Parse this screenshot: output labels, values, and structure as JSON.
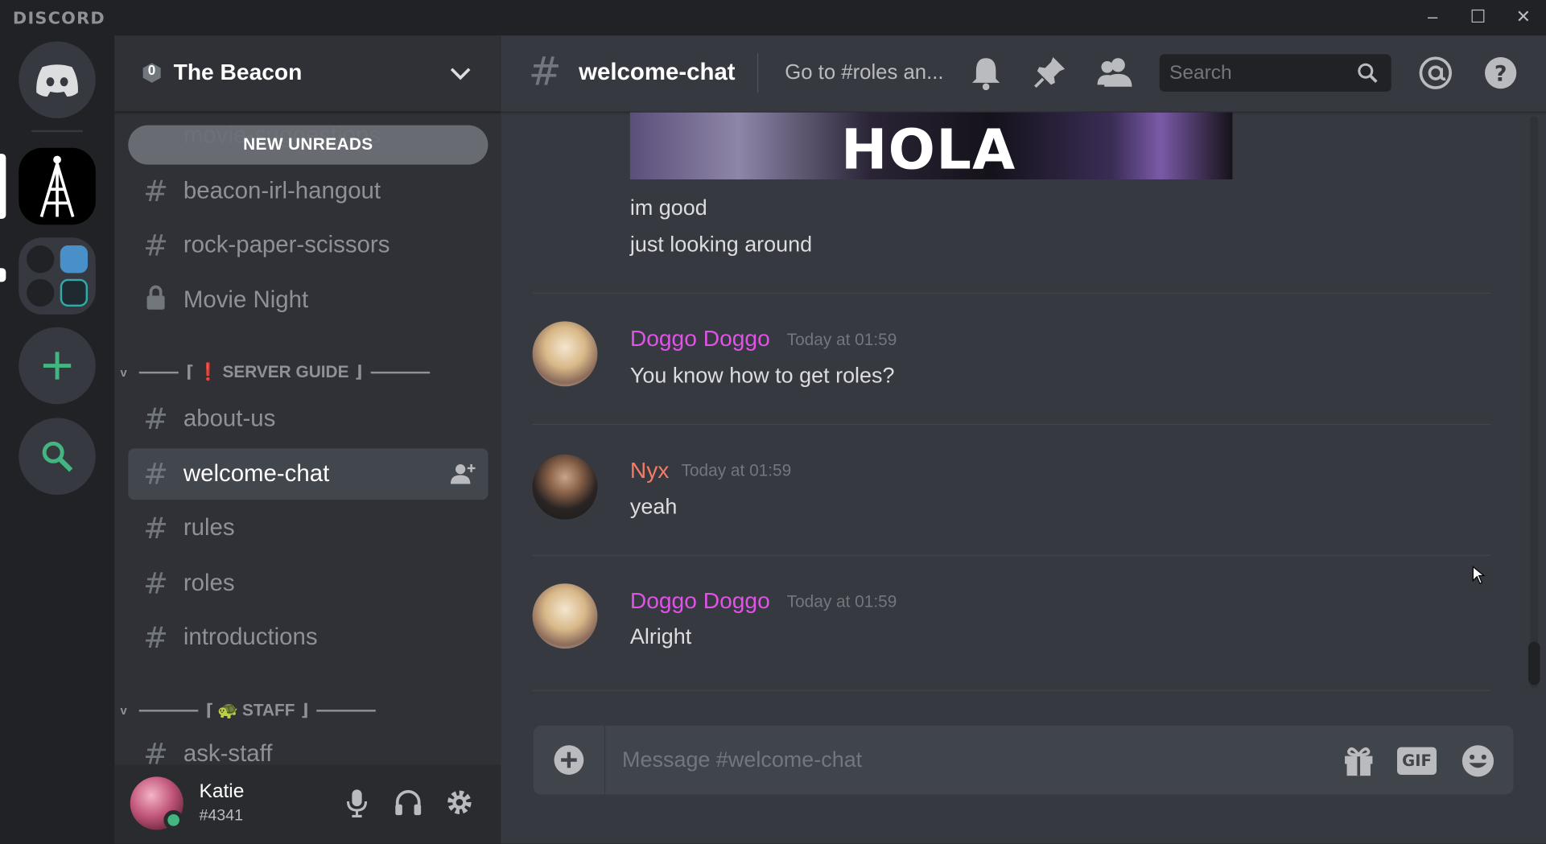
{
  "app": {
    "brand": "DISCORD"
  },
  "window_controls": {
    "minimize": "–",
    "maximize": "☐",
    "close": "✕"
  },
  "server": {
    "name": "The Beacon",
    "boost_count": "0"
  },
  "sidebar": {
    "new_unreads": "NEW UNREADS",
    "ghost_channel": "movie-suggestions",
    "channels_top": [
      {
        "name": "beacon-irl-hangout",
        "icon": "hash-icon"
      },
      {
        "name": "rock-paper-scissors",
        "icon": "hash-icon"
      },
      {
        "name": "Movie Night",
        "icon": "lock-icon"
      }
    ],
    "category_guide": {
      "open": "⌈",
      "emoji": "❗",
      "label": "SERVER GUIDE",
      "close": "⌋"
    },
    "channels_guide": [
      {
        "name": "about-us"
      },
      {
        "name": "welcome-chat",
        "active": true
      },
      {
        "name": "rules"
      },
      {
        "name": "roles"
      },
      {
        "name": "introductions"
      }
    ],
    "category_staff": {
      "open": "⌈",
      "emoji": "🐢",
      "label": "STAFF",
      "close": "⌋"
    },
    "channels_staff": [
      {
        "name": "ask-staff"
      }
    ]
  },
  "user": {
    "name": "Katie",
    "tag": "#4341",
    "status": "online"
  },
  "chat_header": {
    "hash": "#",
    "channel": "welcome-chat",
    "topic": "Go to #roles an...",
    "search_placeholder": "Search"
  },
  "messages": {
    "image_text": "HOLA",
    "continued": [
      "im good",
      "just looking around"
    ],
    "items": [
      {
        "author": "Doggo Doggo",
        "color": "#e052e8",
        "time": "Today at 01:59",
        "text": "You know how to get roles?"
      },
      {
        "author": "Nyx",
        "color": "#f47b67",
        "time": "Today at 01:59",
        "text": "yeah"
      },
      {
        "author": "Doggo Doggo",
        "color": "#e052e8",
        "time": "Today at 01:59",
        "text": "Alright"
      }
    ]
  },
  "composer": {
    "placeholder": "Message #welcome-chat",
    "gif": "GIF"
  },
  "colors": {
    "accent_green": "#43b581",
    "blurple": "#7289da"
  }
}
